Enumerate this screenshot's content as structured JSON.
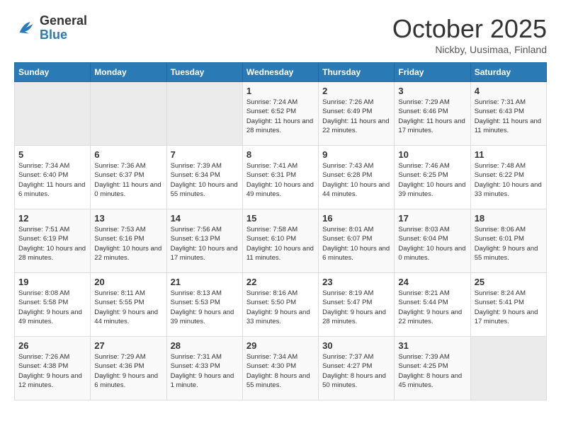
{
  "header": {
    "logo_general": "General",
    "logo_blue": "Blue",
    "month_title": "October 2025",
    "subtitle": "Nickby, Uusimaa, Finland"
  },
  "weekdays": [
    "Sunday",
    "Monday",
    "Tuesday",
    "Wednesday",
    "Thursday",
    "Friday",
    "Saturday"
  ],
  "weeks": [
    [
      {
        "day": "",
        "info": ""
      },
      {
        "day": "",
        "info": ""
      },
      {
        "day": "",
        "info": ""
      },
      {
        "day": "1",
        "info": "Sunrise: 7:24 AM\nSunset: 6:52 PM\nDaylight: 11 hours and 28 minutes."
      },
      {
        "day": "2",
        "info": "Sunrise: 7:26 AM\nSunset: 6:49 PM\nDaylight: 11 hours and 22 minutes."
      },
      {
        "day": "3",
        "info": "Sunrise: 7:29 AM\nSunset: 6:46 PM\nDaylight: 11 hours and 17 minutes."
      },
      {
        "day": "4",
        "info": "Sunrise: 7:31 AM\nSunset: 6:43 PM\nDaylight: 11 hours and 11 minutes."
      }
    ],
    [
      {
        "day": "5",
        "info": "Sunrise: 7:34 AM\nSunset: 6:40 PM\nDaylight: 11 hours and 6 minutes."
      },
      {
        "day": "6",
        "info": "Sunrise: 7:36 AM\nSunset: 6:37 PM\nDaylight: 11 hours and 0 minutes."
      },
      {
        "day": "7",
        "info": "Sunrise: 7:39 AM\nSunset: 6:34 PM\nDaylight: 10 hours and 55 minutes."
      },
      {
        "day": "8",
        "info": "Sunrise: 7:41 AM\nSunset: 6:31 PM\nDaylight: 10 hours and 49 minutes."
      },
      {
        "day": "9",
        "info": "Sunrise: 7:43 AM\nSunset: 6:28 PM\nDaylight: 10 hours and 44 minutes."
      },
      {
        "day": "10",
        "info": "Sunrise: 7:46 AM\nSunset: 6:25 PM\nDaylight: 10 hours and 39 minutes."
      },
      {
        "day": "11",
        "info": "Sunrise: 7:48 AM\nSunset: 6:22 PM\nDaylight: 10 hours and 33 minutes."
      }
    ],
    [
      {
        "day": "12",
        "info": "Sunrise: 7:51 AM\nSunset: 6:19 PM\nDaylight: 10 hours and 28 minutes."
      },
      {
        "day": "13",
        "info": "Sunrise: 7:53 AM\nSunset: 6:16 PM\nDaylight: 10 hours and 22 minutes."
      },
      {
        "day": "14",
        "info": "Sunrise: 7:56 AM\nSunset: 6:13 PM\nDaylight: 10 hours and 17 minutes."
      },
      {
        "day": "15",
        "info": "Sunrise: 7:58 AM\nSunset: 6:10 PM\nDaylight: 10 hours and 11 minutes."
      },
      {
        "day": "16",
        "info": "Sunrise: 8:01 AM\nSunset: 6:07 PM\nDaylight: 10 hours and 6 minutes."
      },
      {
        "day": "17",
        "info": "Sunrise: 8:03 AM\nSunset: 6:04 PM\nDaylight: 10 hours and 0 minutes."
      },
      {
        "day": "18",
        "info": "Sunrise: 8:06 AM\nSunset: 6:01 PM\nDaylight: 9 hours and 55 minutes."
      }
    ],
    [
      {
        "day": "19",
        "info": "Sunrise: 8:08 AM\nSunset: 5:58 PM\nDaylight: 9 hours and 49 minutes."
      },
      {
        "day": "20",
        "info": "Sunrise: 8:11 AM\nSunset: 5:55 PM\nDaylight: 9 hours and 44 minutes."
      },
      {
        "day": "21",
        "info": "Sunrise: 8:13 AM\nSunset: 5:53 PM\nDaylight: 9 hours and 39 minutes."
      },
      {
        "day": "22",
        "info": "Sunrise: 8:16 AM\nSunset: 5:50 PM\nDaylight: 9 hours and 33 minutes."
      },
      {
        "day": "23",
        "info": "Sunrise: 8:19 AM\nSunset: 5:47 PM\nDaylight: 9 hours and 28 minutes."
      },
      {
        "day": "24",
        "info": "Sunrise: 8:21 AM\nSunset: 5:44 PM\nDaylight: 9 hours and 22 minutes."
      },
      {
        "day": "25",
        "info": "Sunrise: 8:24 AM\nSunset: 5:41 PM\nDaylight: 9 hours and 17 minutes."
      }
    ],
    [
      {
        "day": "26",
        "info": "Sunrise: 7:26 AM\nSunset: 4:38 PM\nDaylight: 9 hours and 12 minutes."
      },
      {
        "day": "27",
        "info": "Sunrise: 7:29 AM\nSunset: 4:36 PM\nDaylight: 9 hours and 6 minutes."
      },
      {
        "day": "28",
        "info": "Sunrise: 7:31 AM\nSunset: 4:33 PM\nDaylight: 9 hours and 1 minute."
      },
      {
        "day": "29",
        "info": "Sunrise: 7:34 AM\nSunset: 4:30 PM\nDaylight: 8 hours and 55 minutes."
      },
      {
        "day": "30",
        "info": "Sunrise: 7:37 AM\nSunset: 4:27 PM\nDaylight: 8 hours and 50 minutes."
      },
      {
        "day": "31",
        "info": "Sunrise: 7:39 AM\nSunset: 4:25 PM\nDaylight: 8 hours and 45 minutes."
      },
      {
        "day": "",
        "info": ""
      }
    ]
  ]
}
